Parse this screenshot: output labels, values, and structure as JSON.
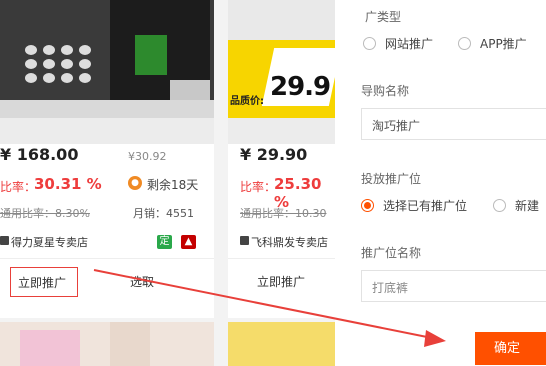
{
  "form": {
    "promo_type_label": "广类型",
    "promo_type_options": [
      "网站推广",
      "APP推广"
    ],
    "guide_name_label": "导购名称",
    "guide_name_value": "淘巧推广",
    "slot_label": "投放推广位",
    "slot_options": [
      "选择已有推广位",
      "新建"
    ],
    "slot_name_label": "推广位名称",
    "slot_name_value": "打底裤",
    "confirm_label": "确定"
  },
  "products": [
    {
      "price": "¥ 168.00",
      "price_partial": "¥30.92",
      "rate_label": "比率：",
      "rate_value": "30.31 %",
      "general_rate": "通用比率：8.30%",
      "remaining": "剩余18天",
      "monthly_sales": "月销：4551",
      "shop": "得力夏星专卖店",
      "promote_btn": "立即推广",
      "select_btn": "选取",
      "badge_ding": "定"
    },
    {
      "banner_label": "品质价:",
      "banner_price": "29.9",
      "price": "¥ 29.90",
      "rate_label": "比率：",
      "rate_value": "25.30 %",
      "general_rate": "通用比率：10.30",
      "shop": "飞科鼎发专卖店",
      "promote_btn": "立即推广"
    }
  ],
  "colors": {
    "accent": "#ff5000",
    "rate": "#ee3c3c",
    "annotation": "#e8403a"
  }
}
